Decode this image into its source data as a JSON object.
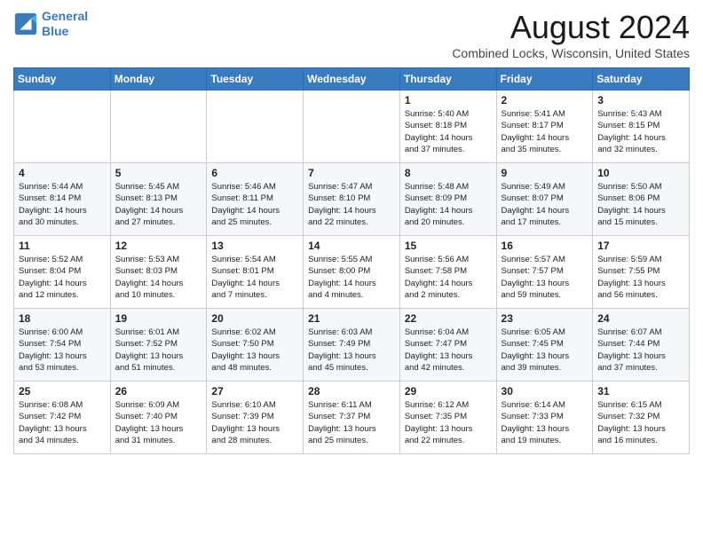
{
  "header": {
    "logo_line1": "General",
    "logo_line2": "Blue",
    "month_year": "August 2024",
    "location": "Combined Locks, Wisconsin, United States"
  },
  "weekdays": [
    "Sunday",
    "Monday",
    "Tuesday",
    "Wednesday",
    "Thursday",
    "Friday",
    "Saturday"
  ],
  "weeks": [
    [
      {
        "day": "",
        "info": ""
      },
      {
        "day": "",
        "info": ""
      },
      {
        "day": "",
        "info": ""
      },
      {
        "day": "",
        "info": ""
      },
      {
        "day": "1",
        "info": "Sunrise: 5:40 AM\nSunset: 8:18 PM\nDaylight: 14 hours\nand 37 minutes."
      },
      {
        "day": "2",
        "info": "Sunrise: 5:41 AM\nSunset: 8:17 PM\nDaylight: 14 hours\nand 35 minutes."
      },
      {
        "day": "3",
        "info": "Sunrise: 5:43 AM\nSunset: 8:15 PM\nDaylight: 14 hours\nand 32 minutes."
      }
    ],
    [
      {
        "day": "4",
        "info": "Sunrise: 5:44 AM\nSunset: 8:14 PM\nDaylight: 14 hours\nand 30 minutes."
      },
      {
        "day": "5",
        "info": "Sunrise: 5:45 AM\nSunset: 8:13 PM\nDaylight: 14 hours\nand 27 minutes."
      },
      {
        "day": "6",
        "info": "Sunrise: 5:46 AM\nSunset: 8:11 PM\nDaylight: 14 hours\nand 25 minutes."
      },
      {
        "day": "7",
        "info": "Sunrise: 5:47 AM\nSunset: 8:10 PM\nDaylight: 14 hours\nand 22 minutes."
      },
      {
        "day": "8",
        "info": "Sunrise: 5:48 AM\nSunset: 8:09 PM\nDaylight: 14 hours\nand 20 minutes."
      },
      {
        "day": "9",
        "info": "Sunrise: 5:49 AM\nSunset: 8:07 PM\nDaylight: 14 hours\nand 17 minutes."
      },
      {
        "day": "10",
        "info": "Sunrise: 5:50 AM\nSunset: 8:06 PM\nDaylight: 14 hours\nand 15 minutes."
      }
    ],
    [
      {
        "day": "11",
        "info": "Sunrise: 5:52 AM\nSunset: 8:04 PM\nDaylight: 14 hours\nand 12 minutes."
      },
      {
        "day": "12",
        "info": "Sunrise: 5:53 AM\nSunset: 8:03 PM\nDaylight: 14 hours\nand 10 minutes."
      },
      {
        "day": "13",
        "info": "Sunrise: 5:54 AM\nSunset: 8:01 PM\nDaylight: 14 hours\nand 7 minutes."
      },
      {
        "day": "14",
        "info": "Sunrise: 5:55 AM\nSunset: 8:00 PM\nDaylight: 14 hours\nand 4 minutes."
      },
      {
        "day": "15",
        "info": "Sunrise: 5:56 AM\nSunset: 7:58 PM\nDaylight: 14 hours\nand 2 minutes."
      },
      {
        "day": "16",
        "info": "Sunrise: 5:57 AM\nSunset: 7:57 PM\nDaylight: 13 hours\nand 59 minutes."
      },
      {
        "day": "17",
        "info": "Sunrise: 5:59 AM\nSunset: 7:55 PM\nDaylight: 13 hours\nand 56 minutes."
      }
    ],
    [
      {
        "day": "18",
        "info": "Sunrise: 6:00 AM\nSunset: 7:54 PM\nDaylight: 13 hours\nand 53 minutes."
      },
      {
        "day": "19",
        "info": "Sunrise: 6:01 AM\nSunset: 7:52 PM\nDaylight: 13 hours\nand 51 minutes."
      },
      {
        "day": "20",
        "info": "Sunrise: 6:02 AM\nSunset: 7:50 PM\nDaylight: 13 hours\nand 48 minutes."
      },
      {
        "day": "21",
        "info": "Sunrise: 6:03 AM\nSunset: 7:49 PM\nDaylight: 13 hours\nand 45 minutes."
      },
      {
        "day": "22",
        "info": "Sunrise: 6:04 AM\nSunset: 7:47 PM\nDaylight: 13 hours\nand 42 minutes."
      },
      {
        "day": "23",
        "info": "Sunrise: 6:05 AM\nSunset: 7:45 PM\nDaylight: 13 hours\nand 39 minutes."
      },
      {
        "day": "24",
        "info": "Sunrise: 6:07 AM\nSunset: 7:44 PM\nDaylight: 13 hours\nand 37 minutes."
      }
    ],
    [
      {
        "day": "25",
        "info": "Sunrise: 6:08 AM\nSunset: 7:42 PM\nDaylight: 13 hours\nand 34 minutes."
      },
      {
        "day": "26",
        "info": "Sunrise: 6:09 AM\nSunset: 7:40 PM\nDaylight: 13 hours\nand 31 minutes."
      },
      {
        "day": "27",
        "info": "Sunrise: 6:10 AM\nSunset: 7:39 PM\nDaylight: 13 hours\nand 28 minutes."
      },
      {
        "day": "28",
        "info": "Sunrise: 6:11 AM\nSunset: 7:37 PM\nDaylight: 13 hours\nand 25 minutes."
      },
      {
        "day": "29",
        "info": "Sunrise: 6:12 AM\nSunset: 7:35 PM\nDaylight: 13 hours\nand 22 minutes."
      },
      {
        "day": "30",
        "info": "Sunrise: 6:14 AM\nSunset: 7:33 PM\nDaylight: 13 hours\nand 19 minutes."
      },
      {
        "day": "31",
        "info": "Sunrise: 6:15 AM\nSunset: 7:32 PM\nDaylight: 13 hours\nand 16 minutes."
      }
    ]
  ]
}
